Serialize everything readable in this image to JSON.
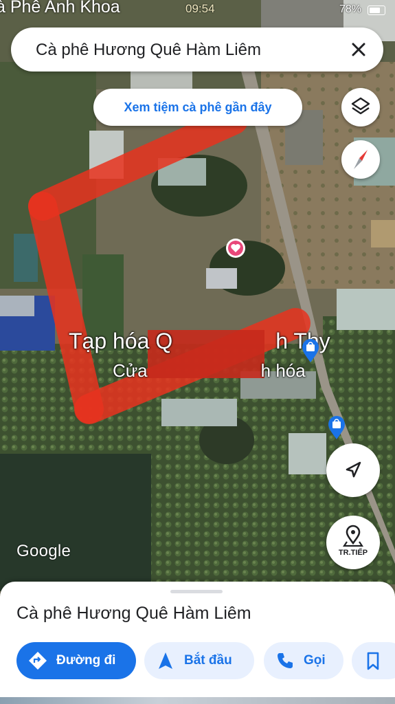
{
  "status_bar": {
    "place_label": "à Phê Anh Khoa",
    "time": "09:54",
    "battery": "78%"
  },
  "search": {
    "query": "Cà phê Hương Quê Hàm Liêm",
    "close_icon": "close-icon"
  },
  "nearby_button": {
    "label": "Xem tiệm cà phê gần đây"
  },
  "map": {
    "labels": [
      "Tạp hóa Q",
      "h Thy",
      "Cửa",
      "h hóa"
    ],
    "attribution": "Google",
    "next_label": "TR.TIẾP"
  },
  "place_sheet": {
    "title": "Cà phê Hương Quê Hàm Liêm",
    "actions": [
      "Đường đi",
      "Bắt đầu",
      "Gọi"
    ]
  },
  "colors": {
    "accent": "#1a73e8",
    "highlight": "#e8321e",
    "chip_bg": "#e8f0fe"
  }
}
